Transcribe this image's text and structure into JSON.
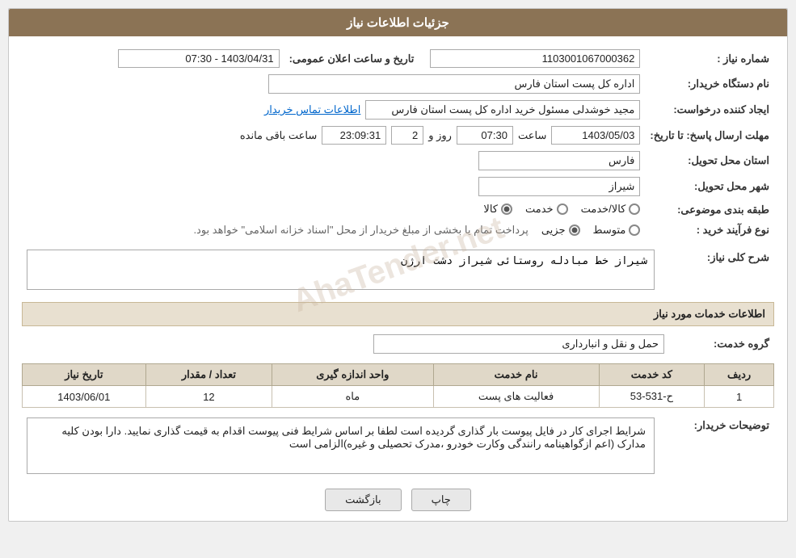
{
  "header": {
    "title": "جزئیات اطلاعات نیاز"
  },
  "fields": {
    "order_number_label": "شماره نیاز :",
    "order_number_value": "1103001067000362",
    "buyer_name_label": "نام دستگاه خریدار:",
    "buyer_name_value": "اداره کل پست استان فارس",
    "creator_label": "ایجاد کننده درخواست:",
    "creator_value": "مجید خوشدلی مسئول خرید اداره کل پست استان فارس",
    "creator_link": "اطلاعات تماس خریدار",
    "date_label": "مهلت ارسال پاسخ: تا تاریخ:",
    "date_from": "1403/05/03",
    "time_from": "07:30",
    "days": "2",
    "time_to": "23:09:31",
    "remaining": "ساعت باقی مانده",
    "public_date_label": "تاریخ و ساعت اعلان عمومی:",
    "public_date_value": "1403/04/31 - 07:30",
    "province_label": "استان محل تحویل:",
    "province_value": "فارس",
    "city_label": "شهر محل تحویل:",
    "city_value": "شیراز",
    "category_label": "طبقه بندی موضوعی:",
    "category_options": [
      {
        "label": "کالا",
        "selected": false
      },
      {
        "label": "خدمت",
        "selected": false
      },
      {
        "label": "کالا/خدمت",
        "selected": false
      }
    ],
    "purchase_type_label": "نوع فرآیند خرید :",
    "purchase_type_options": [
      {
        "label": "جزیی",
        "selected": false
      },
      {
        "label": "متوسط",
        "selected": false
      }
    ],
    "purchase_type_note": "پرداخت تمام یا بخشی از مبلغ خریدار از محل \"اسناد خزانه اسلامی\" خواهد بود.",
    "need_description_label": "شرح کلی نیاز:",
    "need_description_value": "شیراز خط مبادله روستائی شیراز دشت ارژن",
    "services_section_label": "اطلاعات خدمات مورد نیاز",
    "service_group_label": "گروه خدمت:",
    "service_group_value": "حمل و نقل و انبارداری",
    "table": {
      "headers": [
        "ردیف",
        "کد خدمت",
        "نام خدمت",
        "واحد اندازه گیری",
        "تعداد / مقدار",
        "تاریخ نیاز"
      ],
      "rows": [
        {
          "row": "1",
          "code": "ح-531-53",
          "name": "فعالیت های پست",
          "unit": "ماه",
          "quantity": "12",
          "date": "1403/06/01"
        }
      ]
    },
    "buyer_desc_label": "توضیحات خریدار:",
    "buyer_desc_value": "شرایط اجرای کار در فایل پیوست بار گذاری گردیده است لطفا بر اساس شرایط فنی پیوست اقدام به قیمت گذاری نمایید.\nدارا بودن کلیه مدارک (اعم ازگواهینامه رانندگی وکارت خودرو ،مدرک تحصیلی و غیره)الزامی است"
  },
  "buttons": {
    "print": "چاپ",
    "back": "بازگشت"
  }
}
